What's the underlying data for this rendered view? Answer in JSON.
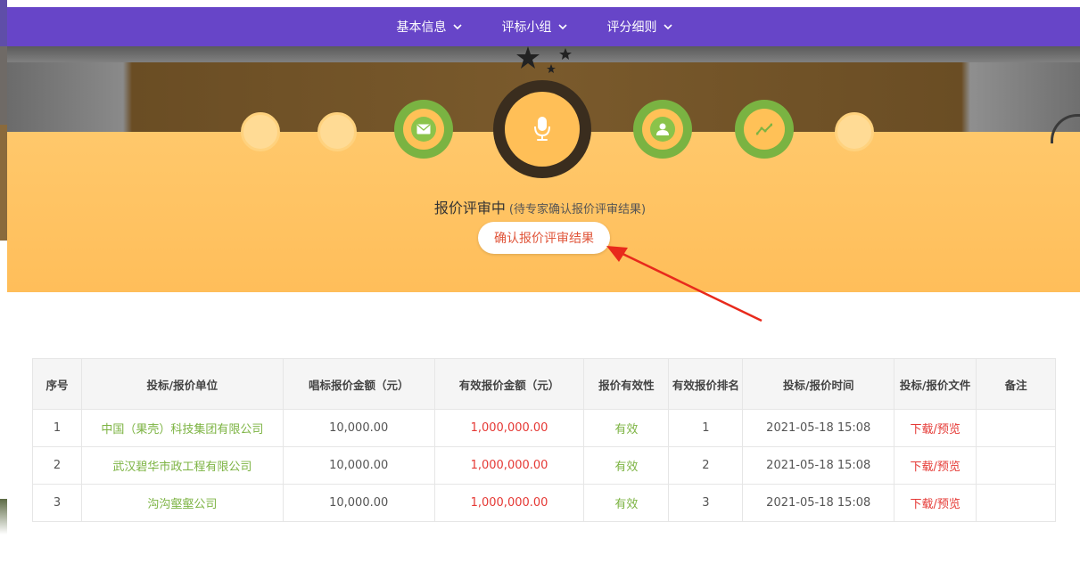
{
  "nav": {
    "items": [
      {
        "label": "基本信息"
      },
      {
        "label": "评标小组"
      },
      {
        "label": "评分细则"
      }
    ]
  },
  "steps": {
    "icons": [
      "dot",
      "dot",
      "mail-icon",
      "mic-icon",
      "user-icon",
      "chart-icon",
      "dot"
    ],
    "active": "mic-icon"
  },
  "status": {
    "title": "报价评审中",
    "subtitle": "(待专家确认报价评审结果)",
    "confirm_button": "确认报价评审结果"
  },
  "table": {
    "headers": [
      "序号",
      "投标/报价单位",
      "唱标报价金额（元）",
      "有效报价金额（元）",
      "报价有效性",
      "有效报价排名",
      "投标/报价时间",
      "投标/报价文件",
      "备注"
    ],
    "rows": [
      {
        "no": "1",
        "company": "中国（果壳）科技集团有限公司",
        "bid": "10,000.00",
        "valid_amount": "1,000,000.00",
        "validity": "有效",
        "rank": "1",
        "time": "2021-05-18 15:08",
        "file": "下载/预览",
        "note": ""
      },
      {
        "no": "2",
        "company": "武汉碧华市政工程有限公司",
        "bid": "10,000.00",
        "valid_amount": "1,000,000.00",
        "validity": "有效",
        "rank": "2",
        "time": "2021-05-18 15:08",
        "file": "下载/预览",
        "note": ""
      },
      {
        "no": "3",
        "company": "沟沟壑壑公司",
        "bid": "10,000.00",
        "valid_amount": "1,000,000.00",
        "validity": "有效",
        "rank": "3",
        "time": "2021-05-18 15:08",
        "file": "下载/预览",
        "note": ""
      }
    ]
  },
  "colors": {
    "nav_bg": "#6745c8",
    "hero_bg": "#ffc86b",
    "accent_green": "#7cb342",
    "accent_red": "#e53935"
  }
}
